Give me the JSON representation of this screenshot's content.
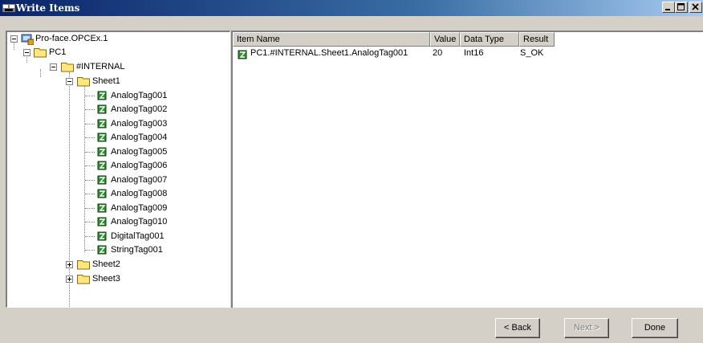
{
  "window": {
    "title": "Write Items",
    "title_icon": "opc-write-icon",
    "controls": [
      "minimize-icon",
      "maximize-icon",
      "close-icon"
    ]
  },
  "tree": {
    "root": "Pro-face.OPCEx.1",
    "pc": "PC1",
    "internal": "#INTERNAL",
    "sheet1": "Sheet1",
    "tags": [
      "AnalogTag001",
      "AnalogTag002",
      "AnalogTag003",
      "AnalogTag004",
      "AnalogTag005",
      "AnalogTag006",
      "AnalogTag007",
      "AnalogTag008",
      "AnalogTag009",
      "AnalogTag010",
      "DigitalTag001",
      "StringTag001"
    ],
    "sheet2": "Sheet2",
    "sheet3": "Sheet3"
  },
  "list": {
    "columns": [
      "Item Name",
      "Value",
      "Data Type",
      "Result"
    ],
    "rows": [
      {
        "item_name": "PC1.#INTERNAL.Sheet1.AnalogTag001",
        "value": "20",
        "data_type": "Int16",
        "result": "S_OK"
      }
    ]
  },
  "buttons": {
    "back": "< Back",
    "next": "Next >",
    "done": "Done"
  },
  "colors": {
    "title_bar": "#0a246a",
    "face": "#d4d0c8",
    "folder": "#ffe680"
  }
}
